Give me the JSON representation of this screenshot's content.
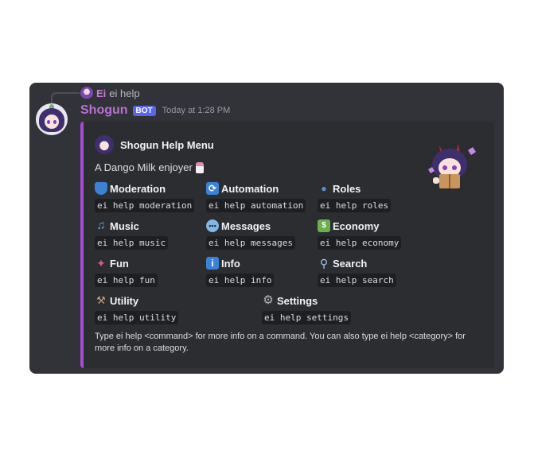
{
  "reply": {
    "name": "Ei",
    "text": "ei help"
  },
  "message": {
    "username": "Shogun",
    "bot_tag": "BOT",
    "timestamp": "Today at 1:28 PM"
  },
  "embed": {
    "author": "Shogun Help Menu",
    "description": "A Dango Milk enjoyer",
    "accent_color": "#a64bd4",
    "fields": [
      {
        "name": "Moderation",
        "value": "ei help moderation",
        "icon": "shield-icon"
      },
      {
        "name": "Automation",
        "value": "ei help automation",
        "icon": "repeat-icon"
      },
      {
        "name": "Roles",
        "value": "ei help roles",
        "icon": "users-icon"
      },
      {
        "name": "Music",
        "value": "ei help music",
        "icon": "music-note-icon"
      },
      {
        "name": "Messages",
        "value": "ei help messages",
        "icon": "speech-bubble-icon"
      },
      {
        "name": "Economy",
        "value": "ei help economy",
        "icon": "money-icon"
      },
      {
        "name": "Fun",
        "value": "ei help fun",
        "icon": "party-popper-icon"
      },
      {
        "name": "Info",
        "value": "ei help info",
        "icon": "info-icon"
      },
      {
        "name": "Search",
        "value": "ei help search",
        "icon": "magnifier-icon"
      },
      {
        "name": "Utility",
        "value": "ei help utility",
        "icon": "tools-icon"
      },
      {
        "name": "Settings",
        "value": "ei help settings",
        "icon": "gear-icon"
      }
    ],
    "footer": "Type ei help <command> for more info on a command. You can also type ei help <category> for more info on a category."
  }
}
